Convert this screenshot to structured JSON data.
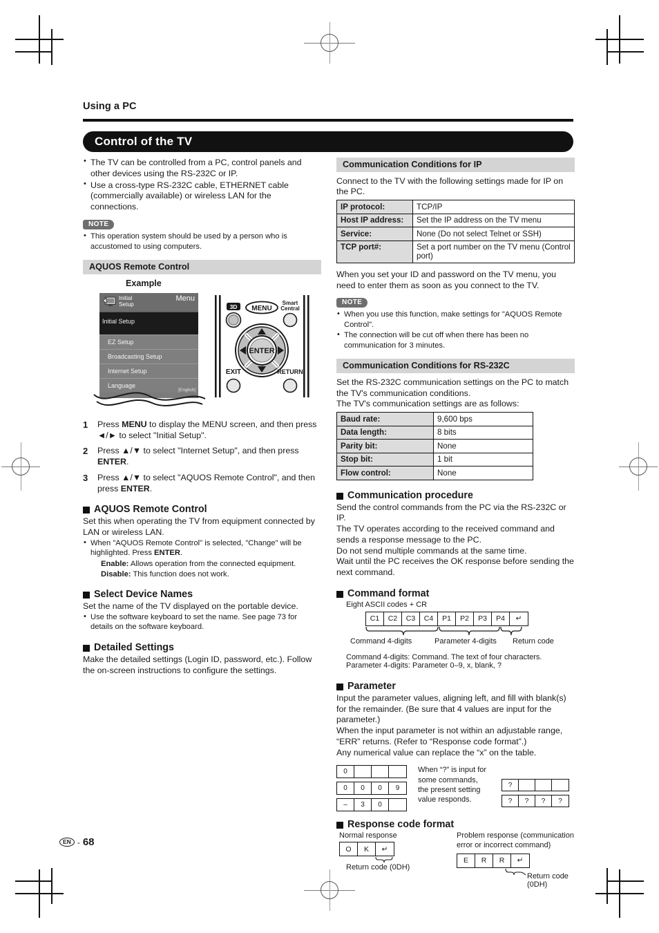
{
  "page": {
    "running_head": "Using a PC",
    "banner_title": "Control of the TV",
    "page_number": "68",
    "lang_badge": "EN",
    "page_dash": "-"
  },
  "left": {
    "intro_bullets": [
      "The TV can be controlled from a PC, control panels and other devices using the RS-232C or IP.",
      "Use a cross-type RS-232C cable, ETHERNET cable (commercially available) or wireless LAN for the connections."
    ],
    "note_label": "NOTE",
    "note_bullets": [
      "This operation system should be used by a person who is accustomed to using computers."
    ],
    "aquos_head": "AQUOS Remote Control",
    "example_label": "Example",
    "tv_menu": {
      "header_title_line1": "Initial",
      "header_title_line2": "Setup",
      "header_right": "Menu",
      "selected_item": "Initial Setup",
      "items": [
        {
          "label": "EZ Setup",
          "value": ""
        },
        {
          "label": "Broadcasting Setup",
          "value": ""
        },
        {
          "label": "Internet Setup",
          "value": ""
        },
        {
          "label": "Language",
          "value": "[English]"
        }
      ]
    },
    "remote": {
      "btn_3d": "3D",
      "btn_menu": "MENU",
      "btn_smart_line1": "Smart",
      "btn_smart_line2": "Central",
      "btn_enter": "ENTER",
      "btn_exit": "EXIT",
      "btn_return": "RETURN"
    },
    "steps": [
      {
        "n": "1",
        "html": "Press <b>MENU</b> to display the MENU screen, and then press ◄/► to select \"Initial Setup\"."
      },
      {
        "n": "2",
        "html": "Press ▲/▼ to select \"Internet Setup\", and then press <b>ENTER</b>."
      },
      {
        "n": "3",
        "html": "Press ▲/▼ to select \"AQUOS Remote Control\", and then press <b>ENTER</b>."
      }
    ],
    "sec_aquos": {
      "title": "AQUOS Remote Control",
      "body": "Set this when operating the TV from equipment connected by LAN or wireless LAN.",
      "bullet": "When \"AQUOS Remote Control\" is selected, \"Change\" will be highlighted. Press <b>ENTER</b>.",
      "enable_label": "Enable:",
      "enable_text": "Allows operation from the connected equipment.",
      "disable_label": "Disable:",
      "disable_text": "This function does not work."
    },
    "sec_device": {
      "title": "Select Device Names",
      "body": "Set the name of the TV displayed on the portable device.",
      "bullet": "Use the software keyboard to set the name. See page 73 for details on the software keyboard."
    },
    "sec_detailed": {
      "title": "Detailed Settings",
      "body": "Make the detailed settings (Login ID, password, etc.). Follow the on-screen instructions to configure the settings."
    }
  },
  "right": {
    "ip_head": "Communication Conditions for IP",
    "ip_intro": "Connect to the TV with the following settings made for IP on the PC.",
    "ip_table": [
      {
        "key": "IP protocol:",
        "value": "TCP/IP"
      },
      {
        "key": "Host IP address:",
        "value": "Set the IP address on the TV menu"
      },
      {
        "key": "Service:",
        "value": "None (Do not select Telnet or SSH)"
      },
      {
        "key": "TCP port#:",
        "value": "Set a port number on the TV menu (Control port)"
      }
    ],
    "ip_after": "When you set your ID and password on the TV menu, you need to enter them as soon as you connect to the TV.",
    "note_label": "NOTE",
    "note_bullets": [
      "When you use this function, make settings for \"AQUOS Remote Control\".",
      "The connection will be cut off when there has been no communication for 3 minutes."
    ],
    "rs_head": "Communication Conditions for RS-232C",
    "rs_intro_1": "Set the RS-232C communication settings on the PC to match the TV's communication conditions.",
    "rs_intro_2": "The TV's communication settings are as follows:",
    "rs_table": [
      {
        "key": "Baud rate:",
        "value": "9,600 bps"
      },
      {
        "key": "Data length:",
        "value": "8 bits"
      },
      {
        "key": "Parity bit:",
        "value": "None"
      },
      {
        "key": "Stop bit:",
        "value": "1 bit"
      },
      {
        "key": "Flow control:",
        "value": "None"
      }
    ],
    "sec_proc": {
      "title": "Communication procedure",
      "body": "Send the control commands from the PC via the RS-232C or IP.\nThe TV operates according to the received command and sends a response message to the PC.\nDo not send multiple commands at the same time.\nWait until the PC receives the OK response before sending the next command."
    },
    "sec_cmdfmt": {
      "title": "Command format",
      "subtitle": "Eight ASCII codes + CR",
      "cells": [
        "C1",
        "C2",
        "C3",
        "C4",
        "P1",
        "P2",
        "P3",
        "P4",
        "↵"
      ],
      "brace_left": "Command 4-digits",
      "brace_mid": "Parameter 4-digits",
      "brace_right": "Return code",
      "line1": "Command 4-digits: Command. The text of four characters.",
      "line2": "Parameter 4-digits: Parameter 0–9, x, blank, ?"
    },
    "sec_param": {
      "title": "Parameter",
      "body": "Input the parameter values, aligning left, and fill with blank(s) for the remainder. (Be sure that 4 values are input for the parameter.)\nWhen the input parameter is not within an adjustable range, “ERR” returns. (Refer to “Response code format”.)\nAny numerical value can replace the “x” on the table.",
      "examples": [
        [
          "0",
          "",
          "",
          ""
        ],
        [
          "0",
          "0",
          "0",
          "9"
        ],
        [
          "–",
          "3",
          "0",
          ""
        ]
      ],
      "q_note": "When “?” is input for some commands, the present setting value responds.",
      "q_examples": [
        [
          "?",
          "",
          "",
          ""
        ],
        [
          "?",
          "?",
          "?",
          "?"
        ]
      ]
    },
    "sec_resp": {
      "title": "Response code format",
      "normal_label": "Normal response",
      "normal_cells": [
        "O",
        "K",
        "↵"
      ],
      "normal_caption": "Return code (0DH)",
      "problem_label": "Problem response (communication error or incorrect command)",
      "problem_cells": [
        "E",
        "R",
        "R",
        "↵"
      ],
      "problem_caption": "Return code (0DH)"
    }
  }
}
